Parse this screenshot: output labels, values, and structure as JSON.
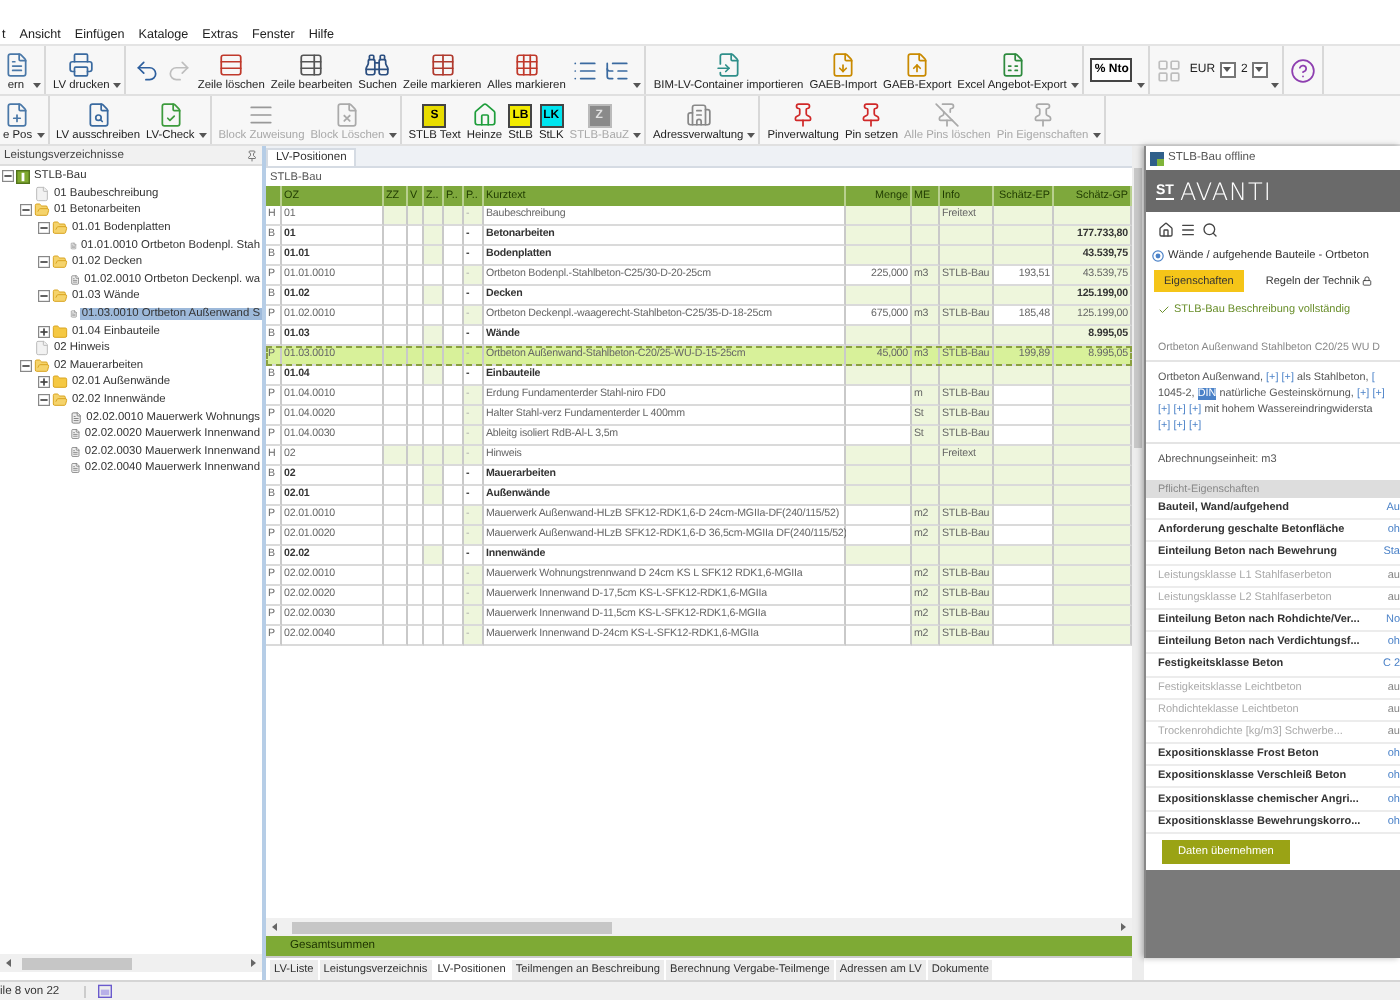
{
  "menu": [
    "t",
    "Ansicht",
    "Einfügen",
    "Kataloge",
    "Extras",
    "Fenster",
    "Hilfe"
  ],
  "toolbar_rows": [
    [
      {
        "dropdown": true,
        "items": [
          {
            "kind": "button",
            "label": "ern",
            "disabled": false
          }
        ]
      },
      {
        "dropdown": true,
        "items": [
          {
            "kind": "button",
            "label": "LV drucken",
            "disabled": false
          }
        ]
      },
      {
        "dropdown": true,
        "items": [
          {
            "kind": "icon",
            "disabled": false
          },
          {
            "kind": "icon",
            "disabled": true
          },
          {
            "kind": "button",
            "label": "Zeile löschen",
            "disabled": false
          },
          {
            "kind": "button",
            "label": "Zeile bearbeiten",
            "disabled": false
          },
          {
            "kind": "button",
            "label": "Suchen",
            "disabled": false
          },
          {
            "kind": "button",
            "label": "Zeile markieren",
            "disabled": false
          },
          {
            "kind": "button",
            "label": "Alles markieren",
            "disabled": false
          },
          {
            "kind": "icon",
            "disabled": false
          },
          {
            "kind": "icon",
            "disabled": false
          }
        ]
      },
      {
        "dropdown": true,
        "items": [
          {
            "kind": "button",
            "label": "BIM-LV-Container importieren",
            "disabled": false
          },
          {
            "kind": "button",
            "label": "GAEB-Import",
            "disabled": false
          },
          {
            "kind": "button",
            "label": "GAEB-Export",
            "disabled": false
          },
          {
            "kind": "button",
            "label": "Excel Angebot-Export",
            "disabled": false
          }
        ]
      },
      {
        "dropdown": true,
        "items": [
          {
            "kind": "badge",
            "badge": "% Nto",
            "color": "#ffffff"
          }
        ]
      },
      {
        "dropdown": true,
        "items": [
          {
            "kind": "icon",
            "disabled": true
          },
          {
            "kind": "select",
            "value": "EUR"
          },
          {
            "kind": "select",
            "value": "2"
          }
        ]
      },
      {
        "dropdown": false,
        "items": [
          {
            "kind": "icon",
            "disabled": false
          }
        ]
      }
    ],
    [
      {
        "dropdown": true,
        "items": [
          {
            "kind": "button",
            "label": "e Pos",
            "disabled": false
          }
        ]
      },
      {
        "dropdown": true,
        "items": [
          {
            "kind": "button",
            "label": "LV ausschreiben",
            "disabled": false
          },
          {
            "kind": "button",
            "label": "LV-Check",
            "disabled": false
          }
        ]
      },
      {
        "dropdown": true,
        "items": [
          {
            "kind": "button",
            "label": "Block Zuweisung",
            "disabled": true
          },
          {
            "kind": "button",
            "label": "Block Löschen",
            "disabled": true
          }
        ]
      },
      {
        "dropdown": true,
        "items": [
          {
            "kind": "badge",
            "badge": "S",
            "color": "#e8dc00",
            "label": "STLB Text",
            "disabled": false
          },
          {
            "kind": "button",
            "label": "Heinze",
            "disabled": false
          },
          {
            "kind": "badge",
            "badge": "LB",
            "color": "#f2ea00",
            "label": "StLB",
            "disabled": false
          },
          {
            "kind": "badge",
            "badge": "LK",
            "color": "#00e5f0",
            "label": "StLK",
            "disabled": false
          },
          {
            "kind": "badge",
            "badge": "Z",
            "color": "#8a8a8a",
            "label": "STLB-BauZ",
            "disabled": true
          }
        ]
      },
      {
        "dropdown": true,
        "items": [
          {
            "kind": "button",
            "label": "Adressverwaltung",
            "disabled": false
          }
        ]
      },
      {
        "dropdown": true,
        "items": [
          {
            "kind": "button",
            "label": "Pinverwaltung",
            "disabled": false
          },
          {
            "kind": "button",
            "label": "Pin setzen",
            "disabled": false
          },
          {
            "kind": "button",
            "label": "Alle Pins löschen",
            "disabled": true
          },
          {
            "kind": "button",
            "label": "Pin Eigenschaften",
            "disabled": true
          }
        ]
      }
    ]
  ],
  "tree": {
    "header": "Leistungsverzeichnisse",
    "nodes": [
      {
        "label": "STLB-Bau",
        "kind": "root",
        "expanded": true,
        "selected": false,
        "children": [
          {
            "label": "01 Baubeschreibung",
            "kind": "doc",
            "selected": false
          },
          {
            "label": "01 Betonarbeiten",
            "kind": "folder",
            "expanded": true,
            "selected": false,
            "children": [
              {
                "label": "01.01 Bodenplatten",
                "kind": "folder",
                "expanded": true,
                "selected": false,
                "children": [
                  {
                    "label": "01.01.0010 Ortbeton Bodenpl. Stah",
                    "kind": "position",
                    "selected": false
                  }
                ]
              },
              {
                "label": "01.02 Decken",
                "kind": "folder",
                "expanded": true,
                "selected": false,
                "children": [
                  {
                    "label": "01.02.0010 Ortbeton Deckenpl. wa",
                    "kind": "position",
                    "selected": false
                  }
                ]
              },
              {
                "label": "01.03 Wände",
                "kind": "folder",
                "expanded": true,
                "selected": false,
                "children": [
                  {
                    "label": "01.03.0010 Ortbeton Außenwand S",
                    "kind": "position",
                    "selected": true
                  }
                ]
              },
              {
                "label": "01.04 Einbauteile",
                "kind": "folder",
                "expanded": false,
                "selected": false
              }
            ]
          },
          {
            "label": "02 Hinweis",
            "kind": "doc",
            "selected": false
          },
          {
            "label": "02 Mauerarbeiten",
            "kind": "folder",
            "expanded": true,
            "selected": false,
            "children": [
              {
                "label": "02.01 Außenwände",
                "kind": "folder",
                "expanded": false,
                "selected": false
              },
              {
                "label": "02.02 Innenwände",
                "kind": "folder",
                "expanded": true,
                "selected": false,
                "children": [
                  {
                    "label": "02.02.0010 Mauerwerk Wohnungs",
                    "kind": "position",
                    "selected": false
                  },
                  {
                    "label": "02.02.0020 Mauerwerk Innenwand",
                    "kind": "position",
                    "selected": false
                  },
                  {
                    "label": "02.02.0030 Mauerwerk Innenwand",
                    "kind": "position",
                    "selected": false
                  },
                  {
                    "label": "02.02.0040 Mauerwerk Innenwand",
                    "kind": "position",
                    "selected": false
                  }
                ]
              }
            ]
          }
        ]
      }
    ]
  },
  "main_tab": "LV-Positionen",
  "caption": "STLB-Bau",
  "table": {
    "columns": [
      "",
      "OZ",
      "ZZ",
      "V",
      "Z..",
      "P..",
      "P..",
      "Kurztext",
      "Menge",
      "ME",
      "Info",
      "Schätz-EP",
      "Schätz-GP"
    ],
    "rows": [
      {
        "kind": "note",
        "type": "H",
        "oz": "01",
        "mark": "-",
        "kurztext": "Baubeschreibung",
        "info": "Freitext",
        "selected": false
      },
      {
        "kind": "group",
        "type": "B",
        "oz": "01",
        "mark": "-",
        "kurztext": "Betonarbeiten",
        "gp": "177.733,80",
        "selected": false
      },
      {
        "kind": "group",
        "type": "B",
        "oz": "01.01",
        "mark": "-",
        "kurztext": "Bodenplatten",
        "gp": "43.539,75",
        "selected": false
      },
      {
        "kind": "item",
        "type": "P",
        "oz": "01.01.0010",
        "mark": "-",
        "kurztext": "Ortbeton Bodenpl.-Stahlbeton-C25/30-D-20-25cm",
        "menge": "225,000",
        "me": "m3",
        "info": "STLB-Bau",
        "ep": "193,51",
        "gp": "43.539,75",
        "selected": false
      },
      {
        "kind": "group",
        "type": "B",
        "oz": "01.02",
        "mark": "-",
        "kurztext": "Decken",
        "gp": "125.199,00",
        "selected": false
      },
      {
        "kind": "item",
        "type": "P",
        "oz": "01.02.0010",
        "mark": "-",
        "kurztext": "Ortbeton Deckenpl.-waagerecht-Stahlbeton-C25/35-D-18-25cm",
        "menge": "675,000",
        "me": "m3",
        "info": "STLB-Bau",
        "ep": "185,48",
        "gp": "125.199,00",
        "selected": false
      },
      {
        "kind": "group",
        "type": "B",
        "oz": "01.03",
        "mark": "-",
        "kurztext": "Wände",
        "gp": "8.995,05",
        "selected": false
      },
      {
        "kind": "item",
        "type": "P",
        "oz": "01.03.0010",
        "mark": "-",
        "kurztext": "Ortbeton Außenwand-Stahlbeton-C20/25-WU-D-15-25cm",
        "menge": "45,000",
        "me": "m3",
        "info": "STLB-Bau",
        "ep": "199,89",
        "gp": "8.995,05",
        "selected": true
      },
      {
        "kind": "group",
        "type": "B",
        "oz": "01.04",
        "mark": "-",
        "kurztext": "Einbauteile",
        "selected": false
      },
      {
        "kind": "item",
        "type": "P",
        "oz": "01.04.0010",
        "mark": "-",
        "kurztext": "Erdung Fundamenterder Stahl-niro FD0",
        "me": "m",
        "info": "STLB-Bau",
        "selected": false
      },
      {
        "kind": "item",
        "type": "P",
        "oz": "01.04.0020",
        "mark": "-",
        "kurztext": "Halter Stahl-verz Fundamenterder L 400mm",
        "me": "St",
        "info": "STLB-Bau",
        "selected": false
      },
      {
        "kind": "item",
        "type": "P",
        "oz": "01.04.0030",
        "mark": "-",
        "kurztext": "Ableitg isoliert RdB-Al-L 3,5m",
        "me": "St",
        "info": "STLB-Bau",
        "selected": false
      },
      {
        "kind": "note",
        "type": "H",
        "oz": "02",
        "mark": "-",
        "kurztext": "Hinweis",
        "info": "Freitext",
        "selected": false
      },
      {
        "kind": "group",
        "type": "B",
        "oz": "02",
        "mark": "-",
        "kurztext": "Mauerarbeiten",
        "selected": false
      },
      {
        "kind": "group",
        "type": "B",
        "oz": "02.01",
        "mark": "-",
        "kurztext": "Außenwände",
        "selected": false
      },
      {
        "kind": "item",
        "type": "P",
        "oz": "02.01.0010",
        "mark": "-",
        "kurztext": "Mauerwerk Außenwand-HLzB SFK12-RDK1,6-D 24cm-MGIIa-DF(240/115/52)",
        "me": "m2",
        "info": "STLB-Bau",
        "selected": false
      },
      {
        "kind": "item",
        "type": "P",
        "oz": "02.01.0020",
        "mark": "-",
        "kurztext": "Mauerwerk Außenwand-HLzB SFK12-RDK1,6-D 36,5cm-MGIIa DF(240/115/52)",
        "me": "m2",
        "info": "STLB-Bau",
        "selected": false
      },
      {
        "kind": "group",
        "type": "B",
        "oz": "02.02",
        "mark": "-",
        "kurztext": "Innenwände",
        "selected": false
      },
      {
        "kind": "item",
        "type": "P",
        "oz": "02.02.0010",
        "mark": "-",
        "kurztext": "Mauerwerk Wohnungstrennwand D 24cm KS L SFK12 RDK1,6-MGIIa",
        "me": "m2",
        "info": "STLB-Bau",
        "selected": false
      },
      {
        "kind": "item",
        "type": "P",
        "oz": "02.02.0020",
        "mark": "-",
        "kurztext": "Mauerwerk Innenwand D-17,5cm KS-L-SFK12-RDK1,6-MGIIa",
        "me": "m2",
        "info": "STLB-Bau",
        "selected": false
      },
      {
        "kind": "item",
        "type": "P",
        "oz": "02.02.0030",
        "mark": "-",
        "kurztext": "Mauerwerk Innenwand D-11,5cm KS-L-SFK12-RDK1,6-MGIIa",
        "me": "m2",
        "info": "STLB-Bau",
        "selected": false
      },
      {
        "kind": "item",
        "type": "P",
        "oz": "02.02.0040",
        "mark": "-",
        "kurztext": "Mauerwerk Innenwand D-24cm KS-L-SFK12-RDK1,6-MGIIa",
        "me": "m2",
        "info": "STLB-Bau",
        "selected": false
      }
    ]
  },
  "totals": "Gesamtsummen",
  "bottom_tabs": [
    {
      "label": "LV-Liste",
      "selected": false
    },
    {
      "label": "Leistungsverzeichnis",
      "selected": false
    },
    {
      "label": "LV-Positionen",
      "selected": true
    },
    {
      "label": "Teilmengen an Beschreibung",
      "selected": false
    },
    {
      "label": "Berechnung Vergabe-Teilmenge",
      "selected": false
    },
    {
      "label": "Adressen am LV",
      "selected": false
    },
    {
      "label": "Dokumente",
      "selected": false
    }
  ],
  "status_bar": "ile 8 von 22",
  "detail": {
    "window_title": "STLB-Bau offline",
    "brand_mark": "ST",
    "brand_name": "AVANTI",
    "breadcrumb": "Wände / aufgehende Bauteile - Ortbeton",
    "tabs": [
      {
        "label": "Eigenschaften",
        "selected": true,
        "locked": false
      },
      {
        "label": "Regeln der Technik",
        "selected": false,
        "locked": true
      }
    ],
    "status": "STLB-Bau Beschreibung vollständig",
    "short_text": "Ortbeton Außenwand Stahlbeton C20/25 WU D",
    "long_text": [
      [
        {
          "kind": "text",
          "text": "Ortbeton Außenwand,"
        },
        {
          "kind": "token",
          "text": "[+]"
        },
        {
          "kind": "token",
          "text": "[+]"
        },
        {
          "kind": "text",
          "text": "als Stahlbeton,"
        },
        {
          "kind": "token",
          "text": "["
        }
      ],
      [
        {
          "kind": "text",
          "text": "1045-2,"
        },
        {
          "kind": "tag",
          "text": "DIN"
        },
        {
          "kind": "text",
          "text": "natürliche Gesteinskörnung,"
        },
        {
          "kind": "token",
          "text": "[+]"
        },
        {
          "kind": "token",
          "text": "[+]"
        }
      ],
      [
        {
          "kind": "token",
          "text": "[+]"
        },
        {
          "kind": "token",
          "text": "[+]"
        },
        {
          "kind": "token",
          "text": "[+]"
        },
        {
          "kind": "text",
          "text": "mit hohem Wassereindringwidersta"
        }
      ],
      [
        {
          "kind": "token",
          "text": "[+]"
        },
        {
          "kind": "token",
          "text": "[+]"
        },
        {
          "kind": "token",
          "text": "[+]"
        }
      ]
    ],
    "unit": "Abrechnungseinheit: m3",
    "section": "Pflicht-Eigenschaften",
    "properties": [
      {
        "name": "Bauteil, Wand/aufgehend",
        "value": "Au",
        "disabled": false
      },
      {
        "name": "Anforderung geschalte Betonfläche",
        "value": "oh",
        "disabled": false
      },
      {
        "name": "Einteilung Beton nach Bewehrung",
        "value": "Sta",
        "disabled": false
      },
      {
        "name": "Leistungsklasse L1 Stahlfaserbeton",
        "value": "au",
        "disabled": true
      },
      {
        "name": "Leistungsklasse L2 Stahlfaserbeton",
        "value": "au",
        "disabled": true
      },
      {
        "name": "Einteilung Beton nach Rohdichte/Ver...",
        "value": "No",
        "disabled": false
      },
      {
        "name": "Einteilung Beton nach Verdichtungsf...",
        "value": "oh",
        "disabled": false
      },
      {
        "name": "Festigkeitsklasse Beton",
        "value": "C 2",
        "disabled": false
      },
      {
        "name": "Festigkeitsklasse Leichtbeton",
        "value": "au",
        "disabled": true
      },
      {
        "name": "Rohdichteklasse Leichtbeton",
        "value": "au",
        "disabled": true
      },
      {
        "name": "Trockenrohdichte [kg/m3] Schwerbe...",
        "value": "au",
        "disabled": true
      },
      {
        "name": "Expositionsklasse Frost Beton",
        "value": "oh",
        "disabled": false
      },
      {
        "name": "Expositionsklasse Verschleiß Beton",
        "value": "oh",
        "disabled": false
      },
      {
        "name": "Expositionsklasse chemischer Angri...",
        "value": "oh",
        "disabled": false
      },
      {
        "name": "Expositionsklasse Bewehrungskorro...",
        "value": "oh",
        "disabled": false
      }
    ],
    "apply_button": "Daten übernehmen"
  }
}
